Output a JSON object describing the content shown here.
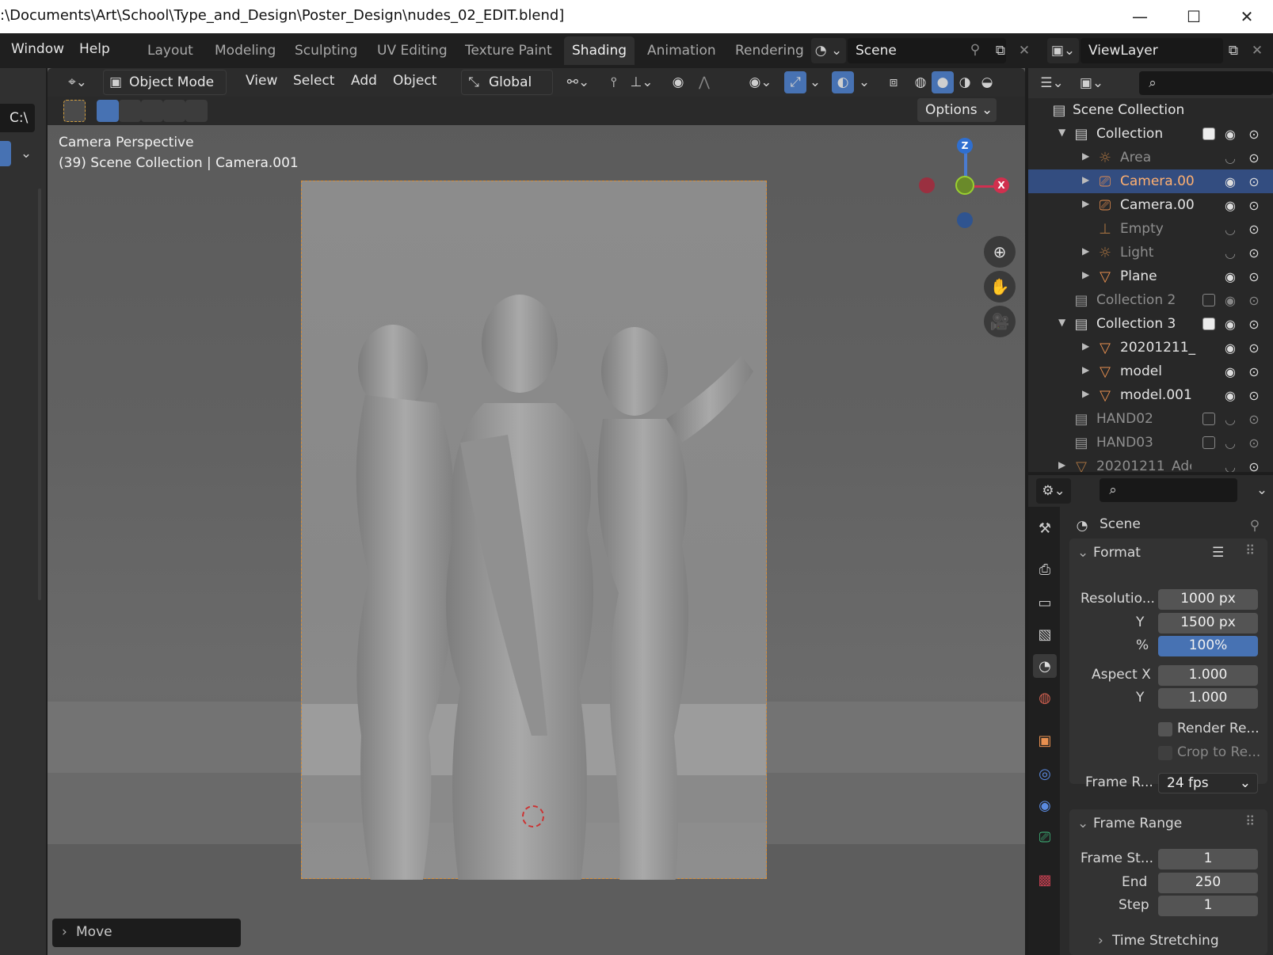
{
  "window": {
    "title": ":\\Documents\\Art\\School\\Type_and_Design\\Poster_Design\\nudes_02_EDIT.blend]",
    "minimize": "—",
    "maximize": "☐",
    "close": "✕"
  },
  "menu": {
    "window": "Window",
    "help": "Help"
  },
  "workspaces": [
    "Layout",
    "Modeling",
    "Sculpting",
    "UV Editing",
    "Texture Paint",
    "Shading",
    "Animation",
    "Rendering"
  ],
  "active_workspace": "Shading",
  "scene": {
    "name": "Scene"
  },
  "view_layer": {
    "name": "ViewLayer"
  },
  "left_strip": {
    "path": "C:\\"
  },
  "viewport_header": {
    "mode": "Object Mode",
    "menus": [
      "View",
      "Select",
      "Add",
      "Object"
    ],
    "orientation": "Global",
    "options": "Options"
  },
  "viewport": {
    "perspective": "Camera Perspective",
    "context": "(39) Scene Collection | Camera.001",
    "last_op": "Move",
    "gizmo": {
      "z": "Z",
      "x": "X"
    }
  },
  "outliner": {
    "root": "Scene Collection",
    "rows": [
      {
        "label": "Collection",
        "level": 1,
        "arrow": "▼",
        "icon": "collection-icon"
      },
      {
        "label": "Area",
        "level": 2,
        "arrow": "▶",
        "icon": "light-icon"
      },
      {
        "label": "Camera.00",
        "level": 2,
        "arrow": "▶",
        "icon": "camera-icon"
      },
      {
        "label": "Camera.00",
        "level": 2,
        "arrow": "▶",
        "icon": "camera-icon"
      },
      {
        "label": "Empty",
        "level": 2,
        "arrow": "",
        "icon": "empty-icon"
      },
      {
        "label": "Light",
        "level": 2,
        "arrow": "▶",
        "icon": "light-icon"
      },
      {
        "label": "Plane",
        "level": 2,
        "arrow": "▶",
        "icon": "mesh-icon"
      },
      {
        "label": "Collection 2",
        "level": 1,
        "arrow": "",
        "icon": "collection-icon"
      },
      {
        "label": "Collection 3",
        "level": 1,
        "arrow": "▼",
        "icon": "collection-icon"
      },
      {
        "label": "20201211_",
        "level": 2,
        "arrow": "▶",
        "icon": "mesh-icon"
      },
      {
        "label": "model",
        "level": 2,
        "arrow": "▶",
        "icon": "mesh-icon"
      },
      {
        "label": "model.001",
        "level": 2,
        "arrow": "▶",
        "icon": "mesh-icon"
      },
      {
        "label": "HAND02",
        "level": 1,
        "arrow": "",
        "icon": "collection-icon"
      },
      {
        "label": "HAND03",
        "level": 1,
        "arrow": "",
        "icon": "collection-icon"
      },
      {
        "label": "20201211_Ade",
        "level": 1,
        "arrow": "▶",
        "icon": "mesh-icon"
      }
    ]
  },
  "properties": {
    "context": "Scene",
    "format": {
      "title": "Format",
      "resolution_label": "Resolutio...",
      "resolution_x": "1000 px",
      "y_label": "Y",
      "resolution_y": "1500 px",
      "percent_label": "%",
      "percent": "100%",
      "aspect_label": "Aspect X",
      "aspect_x": "1.000",
      "aspect_y_label": "Y",
      "aspect_y": "1.000",
      "render_region": "Render Re...",
      "crop_region": "Crop to Re...",
      "frame_rate_label": "Frame R...",
      "frame_rate": "24 fps"
    },
    "frame_range": {
      "title": "Frame Range",
      "start_label": "Frame St...",
      "start": "1",
      "end_label": "End",
      "end": "250",
      "step_label": "Step",
      "step": "1"
    },
    "time_stretching": "Time Stretching"
  },
  "colors": {
    "accent": "#4772b3",
    "selected_row": "#334d80",
    "camera_frame": "#d9903a"
  }
}
